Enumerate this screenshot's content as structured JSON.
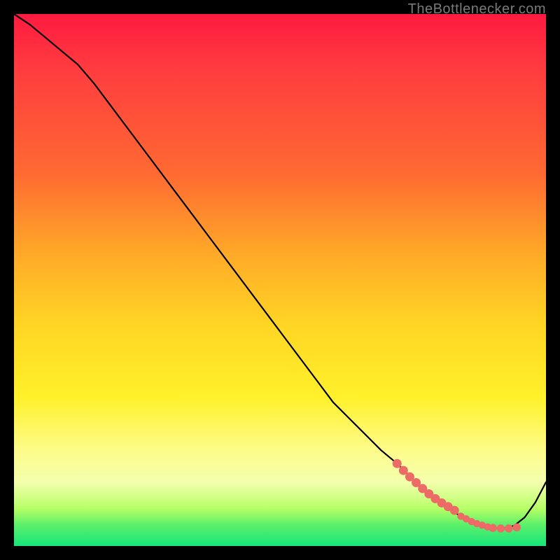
{
  "watermark": "TheBottlenecker.com",
  "colors": {
    "curve": "#000000",
    "marker_fill": "#ec6b66",
    "marker_stroke": "#ec6b66",
    "gradient_top": "#ff1a40",
    "gradient_bottom": "#16e57a"
  },
  "chart_data": {
    "type": "line",
    "title": "",
    "xlabel": "",
    "ylabel": "",
    "xlim": [
      0,
      100
    ],
    "ylim": [
      0,
      100
    ],
    "curve": {
      "x": [
        0,
        3,
        6,
        9,
        12,
        15,
        18,
        21,
        24,
        27,
        30,
        33,
        36,
        39,
        42,
        45,
        48,
        51,
        54,
        57,
        60,
        63,
        66,
        69,
        72,
        74,
        76,
        78,
        80,
        82,
        84,
        86,
        88,
        90,
        92,
        94,
        96,
        98,
        100
      ],
      "y": [
        100,
        98,
        95.5,
        93,
        90.5,
        87,
        83,
        79,
        75,
        71,
        67,
        63,
        59,
        55,
        51,
        47,
        43,
        39,
        35,
        31,
        27,
        24,
        21,
        18,
        15.5,
        13.5,
        11.5,
        9.8,
        8.2,
        6.8,
        5.6,
        4.6,
        3.9,
        3.4,
        3.3,
        3.8,
        5.4,
        8.2,
        12
      ]
    },
    "markers": {
      "x": [
        72.0,
        73.2,
        74.4,
        75.6,
        76.8,
        78.0,
        79.2,
        80.4,
        81.6,
        82.8,
        84.0,
        85.0,
        86.0,
        87.0,
        88.0,
        89.0,
        90.0,
        91.5,
        93.0,
        94.5
      ],
      "y": [
        15.5,
        14.2,
        13.0,
        11.9,
        10.8,
        9.8,
        8.9,
        8.1,
        7.4,
        6.7,
        5.6,
        5.1,
        4.6,
        4.2,
        3.9,
        3.6,
        3.4,
        3.3,
        3.3,
        3.5
      ]
    }
  }
}
